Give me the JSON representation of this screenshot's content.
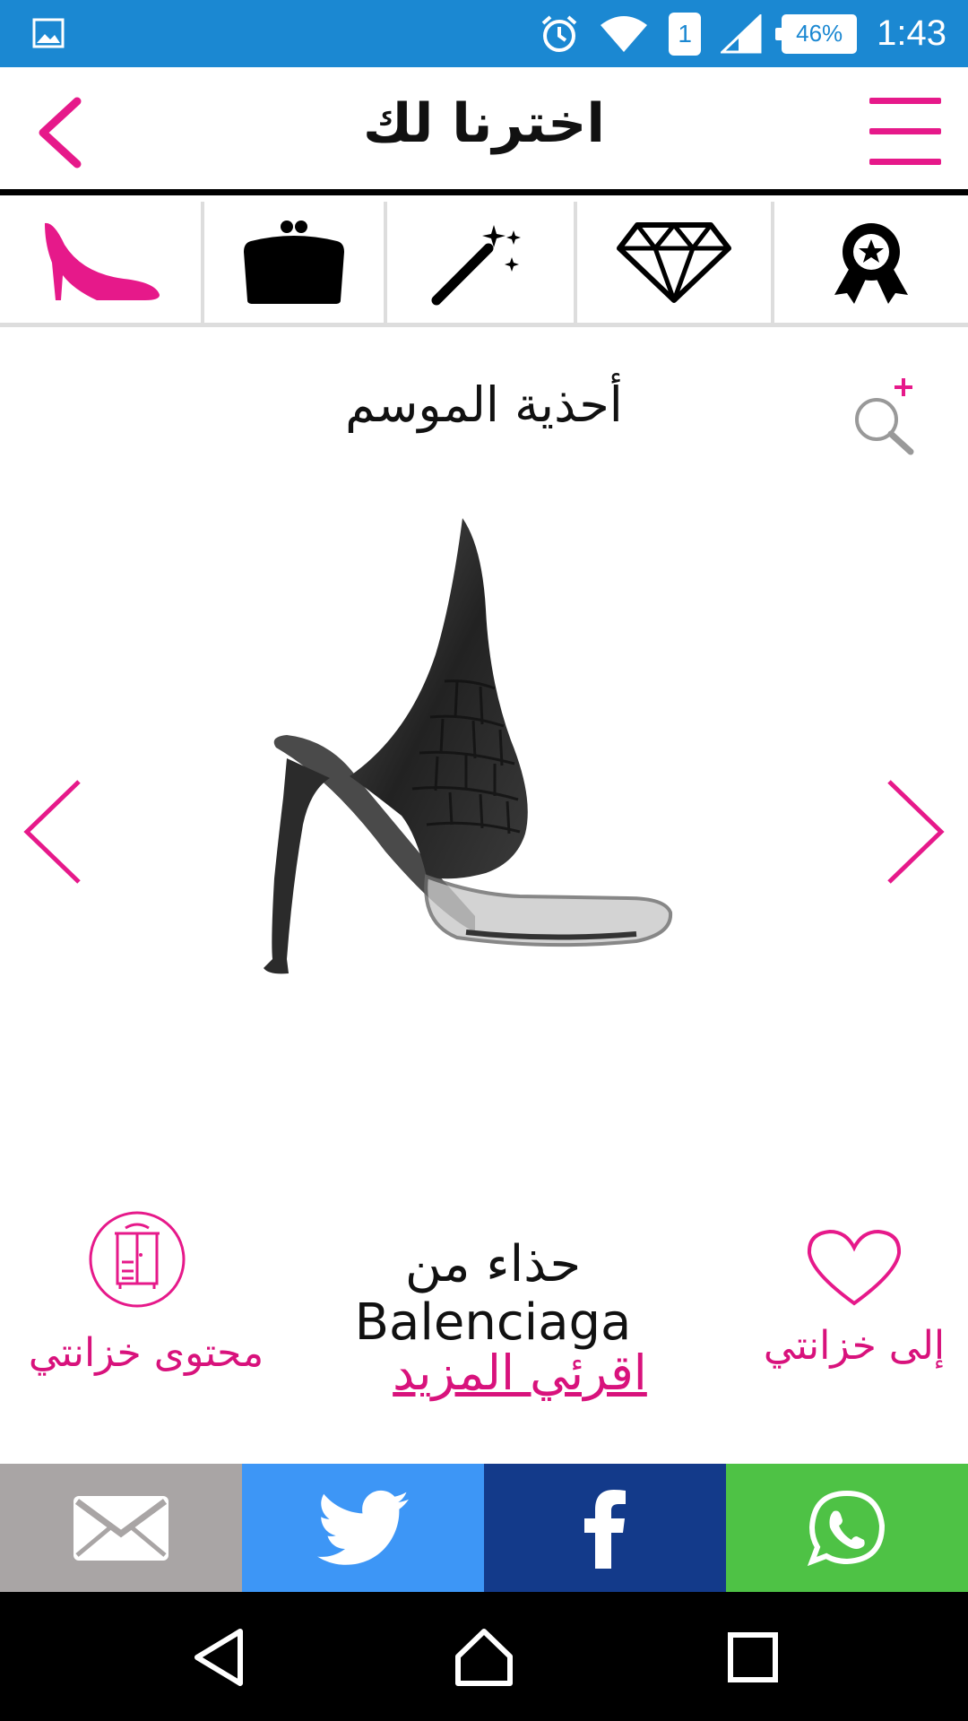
{
  "status_bar": {
    "time": "1:43",
    "battery": "46%",
    "sim": "1",
    "icons": [
      "gallery-icon",
      "alarm-icon",
      "wifi-icon",
      "sim-icon",
      "signal-icon",
      "battery-icon"
    ],
    "background": "#1b88d2"
  },
  "header": {
    "title": "اخترنا لك",
    "accent": "#e6198a"
  },
  "categories": [
    {
      "icon": "high-heel-icon"
    },
    {
      "icon": "purse-icon"
    },
    {
      "icon": "magic-wand-icon"
    },
    {
      "icon": "diamond-icon"
    },
    {
      "icon": "award-ribbon-icon"
    }
  ],
  "section": {
    "title": "أحذية الموسم"
  },
  "product": {
    "name": "حذاء من Balenciaga",
    "read_more": "اقرئي المزيد",
    "add_to_closet": "إلى خزانتي",
    "closet_contents": "محتوى خزانتي"
  },
  "share": {
    "colors": {
      "email": "#a9a5a5",
      "twitter": "#3d96f6",
      "facebook": "#133a8a",
      "whatsapp": "#4ec245"
    }
  }
}
